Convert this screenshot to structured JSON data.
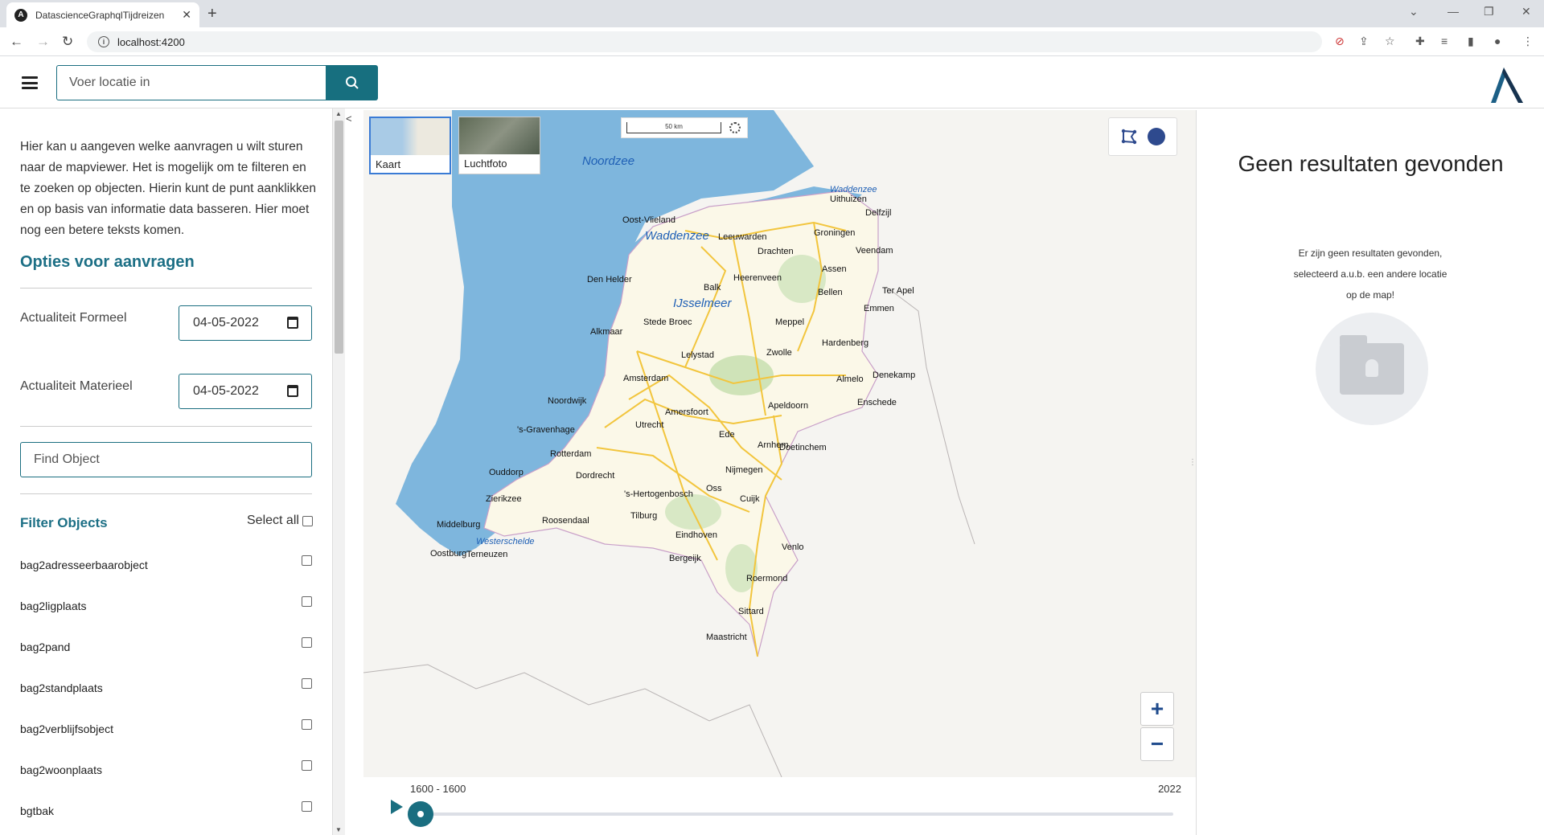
{
  "browser": {
    "tab_title": "DatascienceGraphqlTijdreizen",
    "url": "localhost:4200",
    "favicon_letter": "A"
  },
  "header": {
    "search_placeholder": "Voer locatie in"
  },
  "sidebar": {
    "intro": "Hier kan u aangeven welke aanvragen u wilt sturen naar de mapviewer. Het is mogelijk om te filteren en te zoeken op objecten. Hierin kunt de punt aanklikken en op basis van informatie data basseren. Hier moet nog een betere teksts komen.",
    "options_title": "Opties voor aanvragen",
    "actualiteit_formeel_label": "Actualiteit Formeel",
    "actualiteit_formeel_value": "04-05-2022",
    "actualiteit_materieel_label": "Actualiteit Materieel",
    "actualiteit_materieel_value": "04-05-2022",
    "find_object_placeholder": "Find Object",
    "filter_title": "Filter Objects",
    "select_all_label": "Select all",
    "objects": [
      "bag2adresseerbaarobject",
      "bag2ligplaats",
      "bag2pand",
      "bag2standplaats",
      "bag2verblijfsobject",
      "bag2woonplaats",
      "bgtbak"
    ]
  },
  "map": {
    "layers": [
      "Kaart",
      "Luchtfoto"
    ],
    "active_layer": "Kaart",
    "scale_label": "50 km",
    "water_labels": [
      "Noordzee",
      "Waddenzee",
      "IJsselmeer",
      "Waddenzee",
      "Westerschelde"
    ],
    "places": [
      "Uithuizen",
      "Delfzijl",
      "Oost-Vlieland",
      "Leeuwarden",
      "Groningen",
      "Drachten",
      "Veendam",
      "Assen",
      "Heerenveen",
      "Den Helder",
      "Balk",
      "Bellen",
      "Ter Apel",
      "Emmen",
      "Stede Broec",
      "Meppel",
      "Alkmaar",
      "Hardenberg",
      "Lelystad",
      "Zwolle",
      "Amsterdam",
      "Almelo",
      "Denekamp",
      "Noordwijk",
      "Enschede",
      "Apeldoorn",
      "Amersfoort",
      "'s-Gravenhage",
      "Utrecht",
      "Ede",
      "Arnhem",
      "Doetinchem",
      "Rotterdam",
      "Ouddorp",
      "Dordrecht",
      "Nijmegen",
      "Oss",
      "Cuijk",
      "'s-Hertogenbosch",
      "Zierikzee",
      "Roosendaal",
      "Tilburg",
      "Middelburg",
      "Eindhoven",
      "Oostburg",
      "Terneuzen",
      "Venlo",
      "Bergeijk",
      "Roermond",
      "Sittard",
      "Maastricht"
    ],
    "zoom_in": "+",
    "zoom_out": "−",
    "colors": {
      "water": "#7eb6dd",
      "land": "#f5f4f1",
      "roads": "#f2c53d"
    }
  },
  "timeline": {
    "range_label": "1600 - 1600",
    "end_label": "2022",
    "progress": 0
  },
  "results": {
    "title": "Geen resultaten gevonden",
    "message": "Er zijn geen resultaten gevonden, selecteerd a.u.b. een andere locatie op de map!"
  },
  "accent_color": "#176f7f"
}
